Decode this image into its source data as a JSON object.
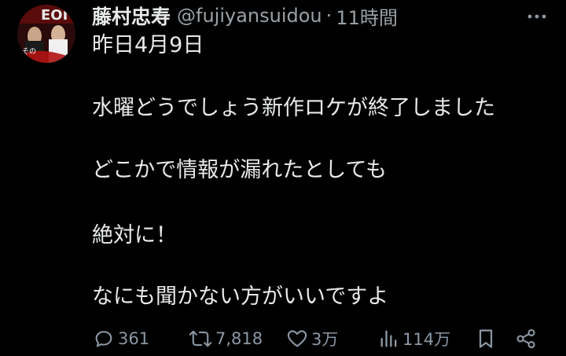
{
  "tweet": {
    "author_name": "藤村忠寿",
    "handle": "@fujiyansuidou",
    "separator": "·",
    "time": "11時間",
    "lines": [
      "昨日4月9日",
      "水曜どうでしょう新作ロケが終了しました",
      "どこかで情報が漏れたとしても",
      "絶対に！",
      "なにも聞かない方がいいですよ"
    ]
  },
  "avatar": {
    "text_top": "EOI",
    "text_bottom": "その",
    "colors": [
      "#2a0a0a",
      "#b31212",
      "#d8d8d8"
    ]
  },
  "actions": {
    "reply": {
      "icon": "reply-icon",
      "count": "361"
    },
    "repost": {
      "icon": "repost-icon",
      "count": "7,818"
    },
    "like": {
      "icon": "heart-icon",
      "count": "3万"
    },
    "views": {
      "icon": "views-icon",
      "count": "114万"
    },
    "bookmark": {
      "icon": "bookmark-icon"
    },
    "share": {
      "icon": "share-icon"
    }
  },
  "colors": {
    "background": "#000000",
    "text": "#e7e9ea",
    "muted": "#9aa0a6",
    "icon": "#8b98a5"
  }
}
